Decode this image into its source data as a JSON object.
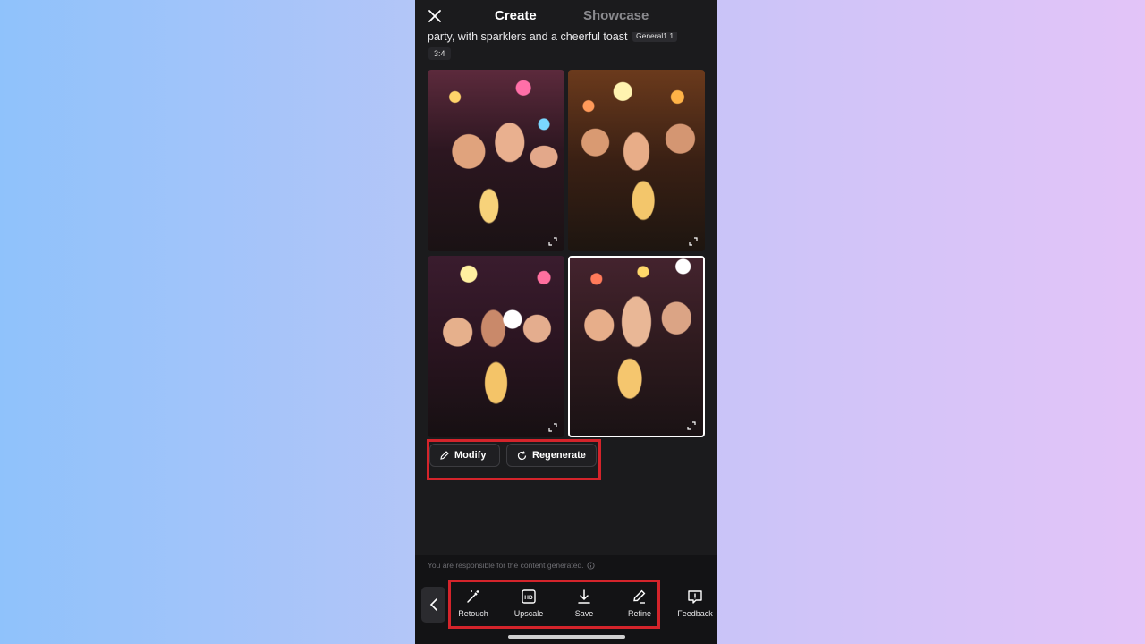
{
  "header": {
    "tabs": [
      {
        "label": "Create",
        "active": true
      },
      {
        "label": "Showcase",
        "active": false
      }
    ]
  },
  "prompt": {
    "text": "party, with sparklers and a cheerful toast",
    "model_badge": "General1.1",
    "aspect_ratio": "3:4"
  },
  "images": {
    "count": 4,
    "selected_index": 4
  },
  "actions": {
    "modify_label": "Modify",
    "regenerate_label": "Regenerate"
  },
  "footer": {
    "disclaimer": "You are responsible for the content generated."
  },
  "toolbar": {
    "retouch": "Retouch",
    "upscale": "Upscale",
    "save": "Save",
    "refine": "Refine",
    "feedback": "Feedback"
  },
  "colors": {
    "accent_highlight": "#d4242b",
    "panel_bg": "#1b1b1d",
    "toolbar_bg": "#131315"
  }
}
